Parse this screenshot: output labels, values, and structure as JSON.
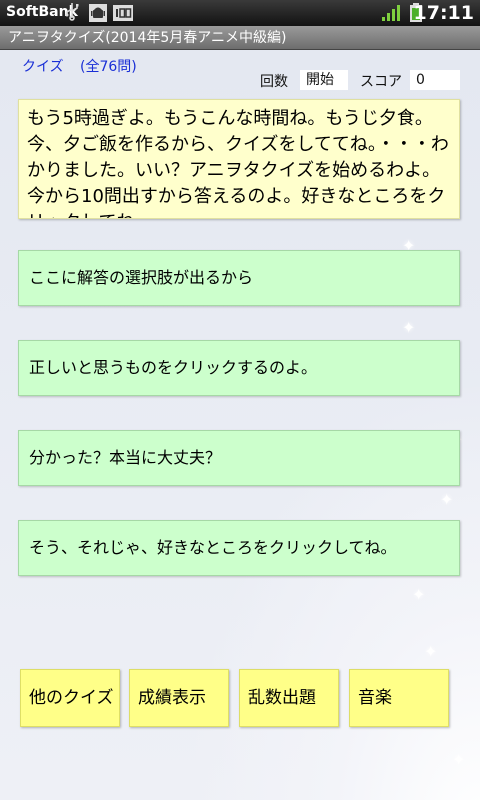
{
  "status_bar": {
    "carrier": "SoftBank",
    "time": "17:11",
    "icons": [
      "usb-icon",
      "debug-icon",
      "hundred-icon",
      "signal-icon",
      "battery-icon"
    ]
  },
  "app": {
    "title": "アニヲタクイズ(2014年5月春アニメ中級編)"
  },
  "quiz": {
    "label": "クイズ",
    "count": "(全76問)"
  },
  "status": {
    "round_label": "回数",
    "round_value": "開始",
    "score_label": "スコア",
    "score_value": "0"
  },
  "message": "もう5時過ぎよ。もうこんな時間ね。もうじ夕食。今、夕ご飯を作るから、クイズをしててね。・・・わかりました。いい？アニヲタクイズを始めるわよ。今から10問出すから答えるのよ。好きなところをクリックしてね。",
  "choices": [
    "ここに解答の選択肢が出るから",
    "正しいと思うものをクリックするのよ。",
    "分かった？本当に大丈夫？",
    "そう、それじゃ、好きなところをクリックしてね。"
  ],
  "menu": [
    "他のクイズ",
    "成績表示",
    "乱数出題",
    "音楽"
  ],
  "colors": {
    "message_bg": "#ffffcc",
    "choice_bg": "#ccffcc",
    "menu_bg": "#ffff88",
    "quiz_title": "#1a2fd6"
  }
}
